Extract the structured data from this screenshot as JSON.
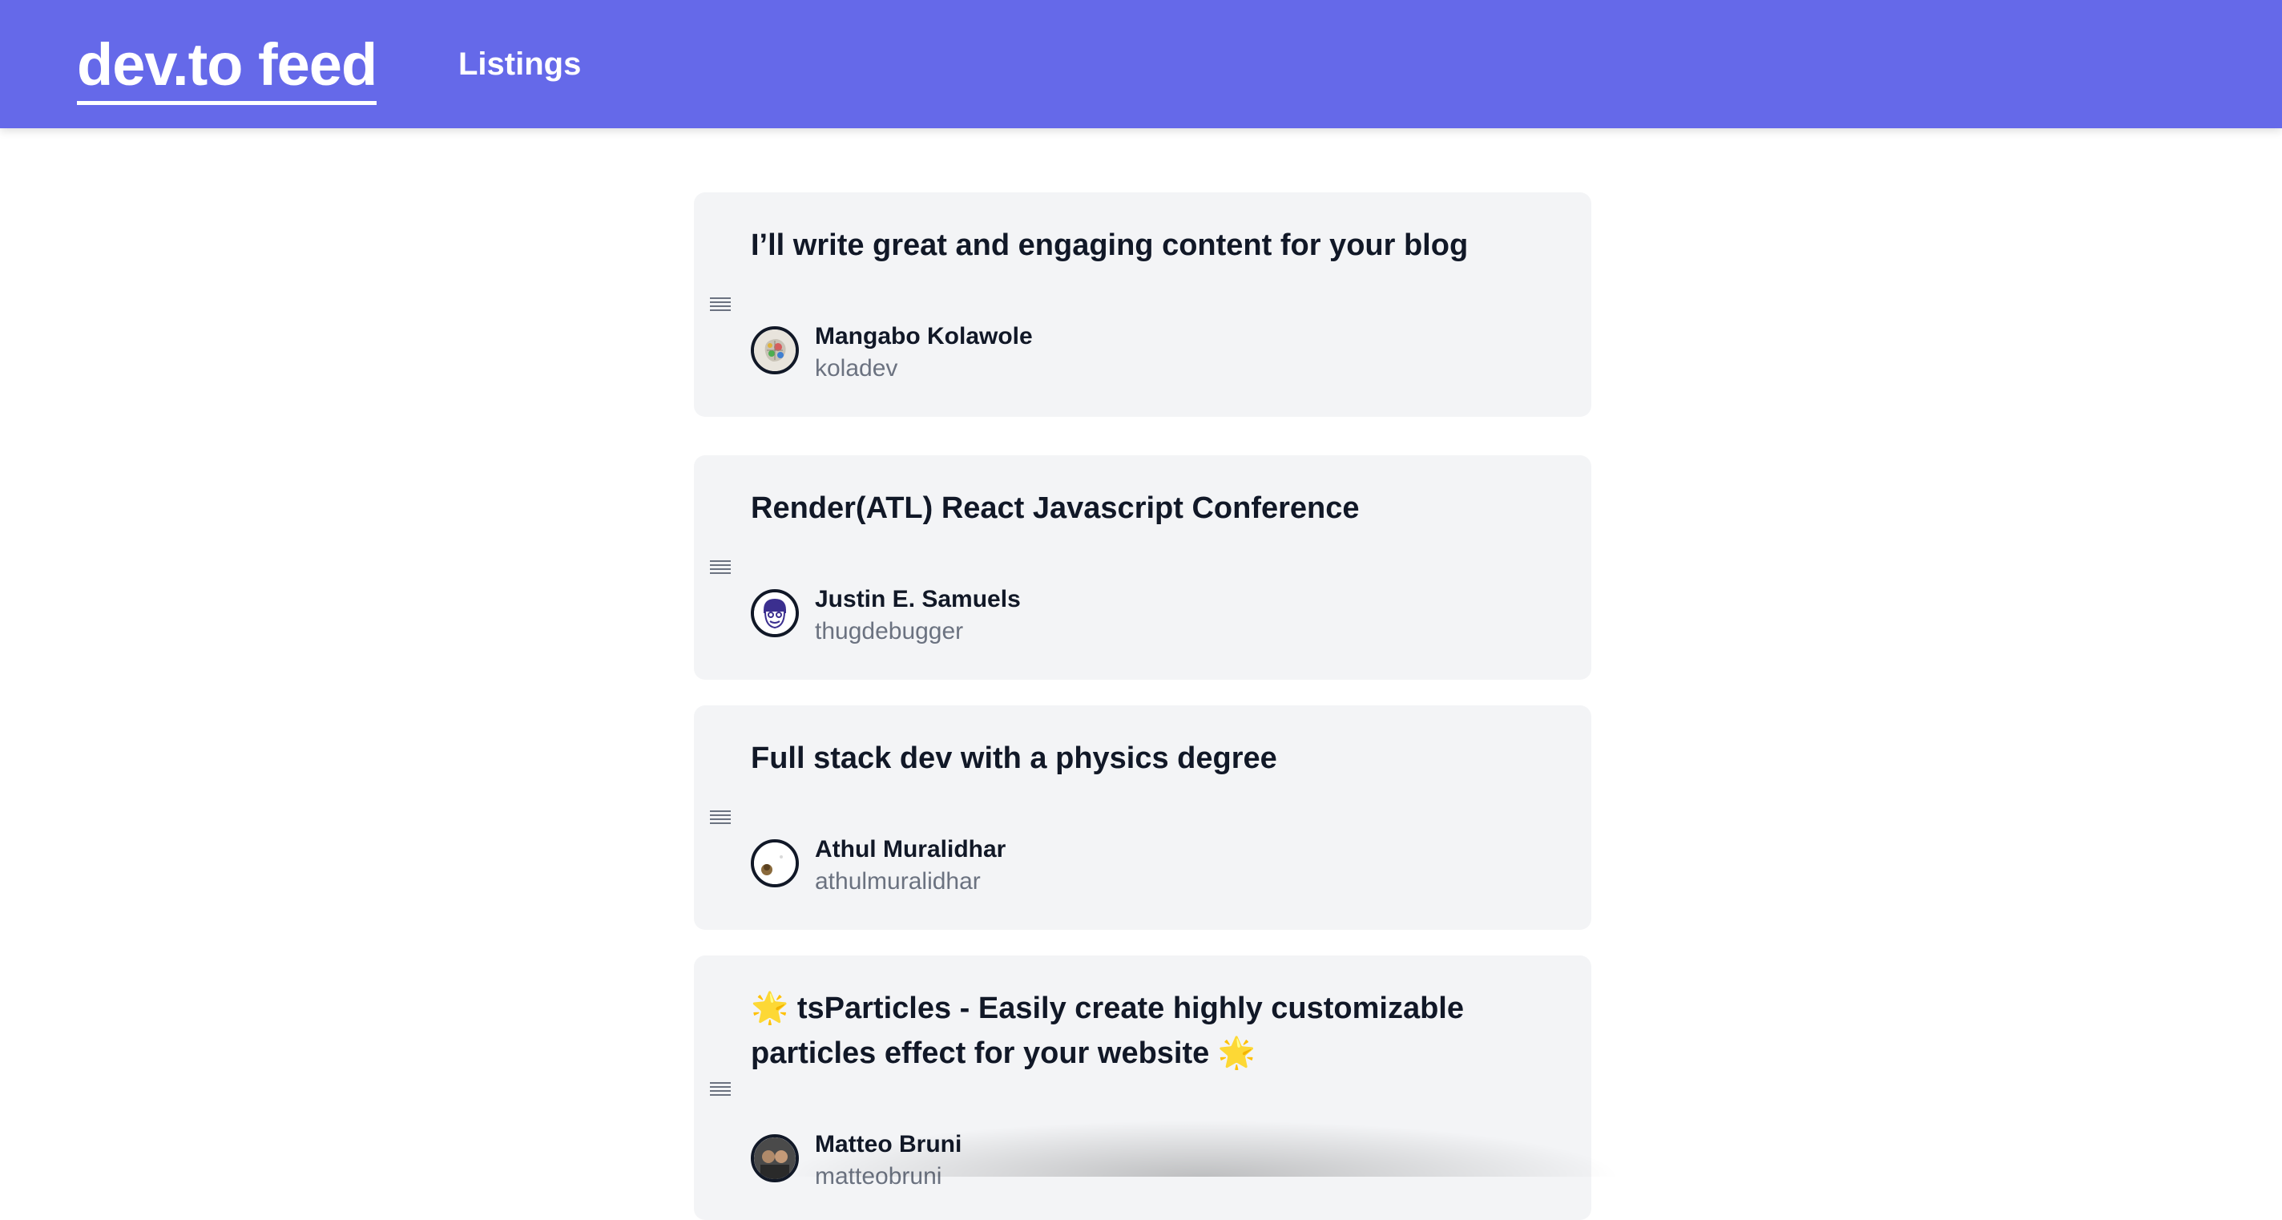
{
  "header": {
    "brand": "dev.to feed",
    "nav_listings": "Listings"
  },
  "colors": {
    "header_bg": "#6569e9",
    "card_bg": "#f3f4f6",
    "title_text": "#111827",
    "handle_text": "#6b7280"
  },
  "listings": [
    {
      "title": "I’ll write great and engaging content for your blog",
      "author_name": "Mangabo Kolawole",
      "author_handle": "koladev",
      "handle_icon": "drag-handle-icon"
    },
    {
      "title": "Render(ATL) React Javascript Conference",
      "author_name": "Justin E. Samuels",
      "author_handle": "thugdebugger",
      "handle_icon": "drag-handle-icon"
    },
    {
      "title": "Full stack dev with a physics degree",
      "author_name": "Athul Muralidhar",
      "author_handle": "athulmuralidhar",
      "handle_icon": "drag-handle-icon"
    },
    {
      "title": "🌟 tsParticles - Easily create highly customizable particles effect for your website 🌟",
      "author_name": "Matteo Bruni",
      "author_handle": "matteobruni",
      "handle_icon": "drag-handle-icon"
    }
  ]
}
